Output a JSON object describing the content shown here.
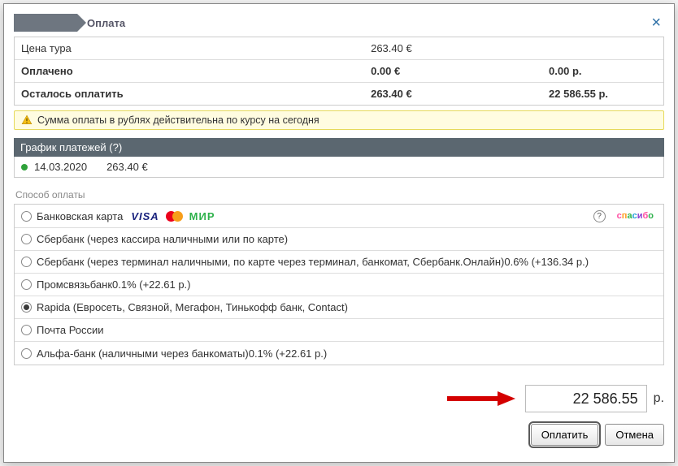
{
  "header": {
    "title": "Оплата",
    "close_label": "×"
  },
  "summary": {
    "price_label": "Цена тура",
    "price_eur": "263.40 €",
    "paid_label": "Оплачено",
    "paid_eur": "0.00 €",
    "paid_rub": "0.00 р.",
    "remain_label": "Осталось оплатить",
    "remain_eur": "263.40 €",
    "remain_rub": "22 586.55 р."
  },
  "notice": {
    "text": "Сумма оплаты в рублях действительна по курсу на сегодня"
  },
  "schedule": {
    "header": "График платежей (?)",
    "date": "14.03.2020",
    "amount": "263.40 €"
  },
  "methods": {
    "label": "Способ оплаты",
    "items": [
      {
        "label": "Банковская карта",
        "checked": false,
        "cards": true
      },
      {
        "label": "Сбербанк (через кассира наличными или по карте)",
        "checked": false
      },
      {
        "label": "Сбербанк (через терминал наличными, по карте через терминал, банкомат, Сбербанк.Онлайн)0.6% (+136.34 р.)",
        "checked": false
      },
      {
        "label": "Промсвязьбанк0.1% (+22.61 р.)",
        "checked": false
      },
      {
        "label": "Rapida (Евросеть, Связной, Мегафон, Тинькофф банк, Contact)",
        "checked": true
      },
      {
        "label": "Почта России",
        "checked": false
      },
      {
        "label": "Альфа-банк (наличными через банкоматы)0.1% (+22.61 р.)",
        "checked": false
      }
    ]
  },
  "cards": {
    "visa": "VISA",
    "mir": "МИР",
    "help": "?",
    "spasibo": "спасибо"
  },
  "amount": {
    "value": "22 586.55",
    "currency": "р."
  },
  "buttons": {
    "pay": "Оплатить",
    "cancel": "Отмена"
  }
}
